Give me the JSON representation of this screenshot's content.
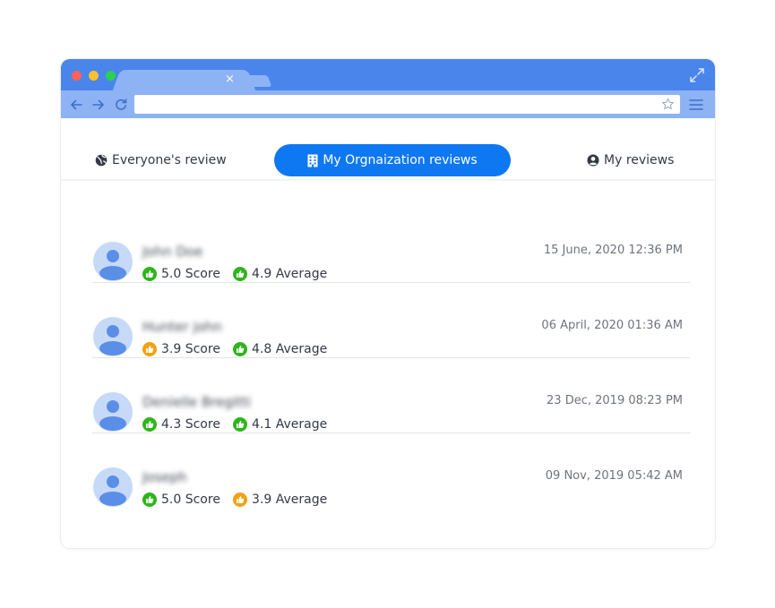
{
  "browser": {
    "url": "",
    "tab_close_glyph": "×"
  },
  "review_tabs": [
    {
      "label": "Everyone's review",
      "icon": "globe-icon",
      "active": false
    },
    {
      "label": "My Orgnaization reviews",
      "icon": "building-icon",
      "active": true
    },
    {
      "label": "My reviews",
      "icon": "user-circle-icon",
      "active": false
    }
  ],
  "colors": {
    "titlebar": "#4a85ec",
    "addressbar": "#8db3f4",
    "accent": "#0d78f2",
    "good": "#2fb51c",
    "medium": "#f2a210"
  },
  "reviews": [
    {
      "name": "John Doe",
      "date": "15 June, 2020 12:36 PM",
      "score": "5.0 Score",
      "score_level": "good",
      "average": "4.9 Average",
      "average_level": "good"
    },
    {
      "name": "Hunter john",
      "date": "06 April, 2020 01:36 AM",
      "score": "3.9 Score",
      "score_level": "medium",
      "average": "4.8 Average",
      "average_level": "good"
    },
    {
      "name": "Denielle Bregitti",
      "date": "23 Dec, 2019 08:23 PM",
      "score": "4.3 Score",
      "score_level": "good",
      "average": "4.1 Average",
      "average_level": "good"
    },
    {
      "name": "Joseph",
      "date": "09 Nov, 2019 05:42 AM",
      "score": "5.0 Score",
      "score_level": "good",
      "average": "3.9 Average",
      "average_level": "medium"
    }
  ]
}
